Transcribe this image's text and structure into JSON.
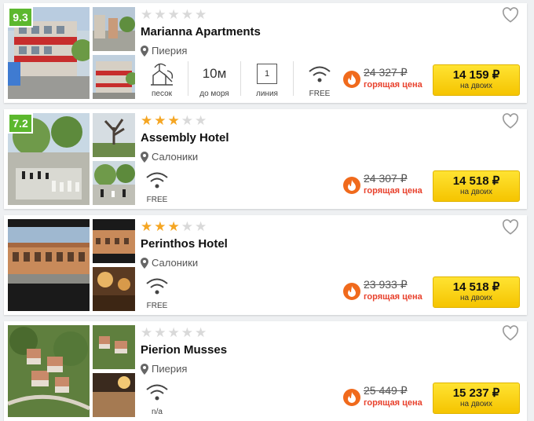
{
  "hotels": [
    {
      "rating": "9.3",
      "stars": 0,
      "name": "Marianna Apartments",
      "location": "Пиерия",
      "amenities": {
        "beach_label": "песок",
        "distance_value": "10м",
        "distance_label": "до моря",
        "line_value": "1",
        "line_label": "линия",
        "wifi_label": "FREE"
      },
      "old_price": "24 327 ₽",
      "hot_label": "горящая цена",
      "price": "14 159 ₽",
      "price_sub": "на двоих"
    },
    {
      "rating": "7.2",
      "stars": 3,
      "name": "Assembly Hotel",
      "location": "Салоники",
      "amenities": {
        "wifi_label": "FREE"
      },
      "old_price": "24 307 ₽",
      "hot_label": "горящая цена",
      "price": "14 518 ₽",
      "price_sub": "на двоих"
    },
    {
      "stars": 3,
      "name": "Perinthos Hotel",
      "location": "Салоники",
      "amenities": {
        "wifi_label": "FREE"
      },
      "old_price": "23 933 ₽",
      "hot_label": "горящая цена",
      "price": "14 518 ₽",
      "price_sub": "на двоих"
    },
    {
      "stars": 0,
      "name": "Pierion Musses",
      "location": "Пиерия",
      "amenities": {
        "wifi_label": "n/a"
      },
      "old_price": "25 449 ₽",
      "hot_label": "горящая цена",
      "price": "15 237 ₽",
      "price_sub": "на двоих"
    }
  ],
  "colors": {
    "rating_badge": "#5cb82e",
    "star_on": "#f5a623",
    "star_off": "#d9d9d9",
    "hot_price": "#e8412c",
    "button": "#ffd600"
  }
}
